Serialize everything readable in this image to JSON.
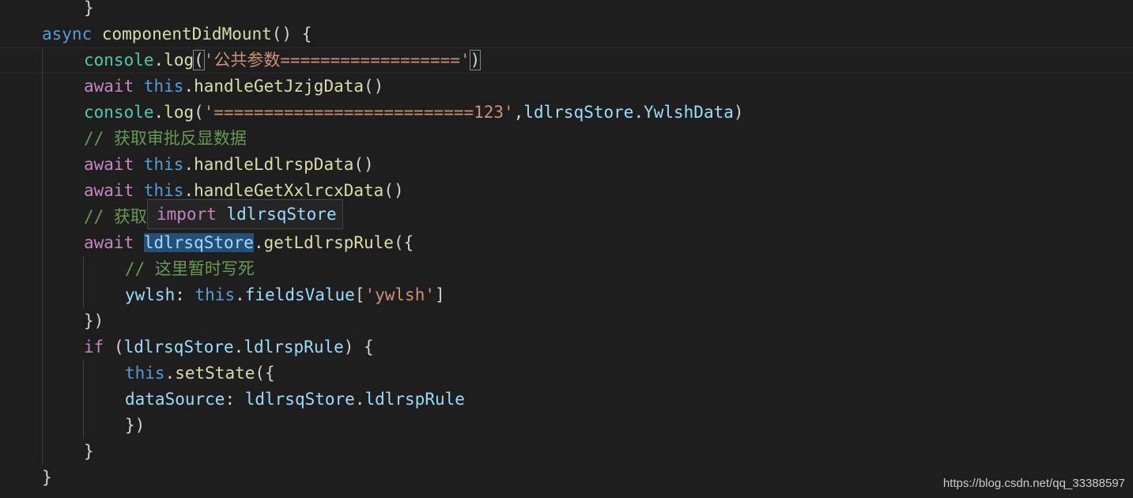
{
  "editor": {
    "lines": [
      [
        {
          "t": "}",
          "c": "pn"
        }
      ],
      [
        {
          "t": "async ",
          "c": "kw"
        },
        {
          "t": "componentDidMount",
          "c": "fn"
        },
        {
          "t": "() {",
          "c": "pn"
        }
      ],
      [
        {
          "t": "console",
          "c": "obj"
        },
        {
          "t": ".",
          "c": "pn"
        },
        {
          "t": "log",
          "c": "fn"
        },
        {
          "t": "(",
          "c": "pn",
          "b": 1
        },
        {
          "t": "'公共参数=================='",
          "c": "str"
        },
        {
          "t": ")",
          "c": "pn",
          "b": 1
        }
      ],
      [
        {
          "t": "await ",
          "c": "kw2"
        },
        {
          "t": "this",
          "c": "kw"
        },
        {
          "t": ".",
          "c": "pn"
        },
        {
          "t": "handleGetJzjgData",
          "c": "fn"
        },
        {
          "t": "()",
          "c": "pn"
        }
      ],
      [
        {
          "t": "console",
          "c": "obj"
        },
        {
          "t": ".",
          "c": "pn"
        },
        {
          "t": "log",
          "c": "fn"
        },
        {
          "t": "(",
          "c": "pn"
        },
        {
          "t": "'==========================123'",
          "c": "str"
        },
        {
          "t": ",",
          "c": "pn"
        },
        {
          "t": "ldlrsqStore",
          "c": "var"
        },
        {
          "t": ".",
          "c": "pn"
        },
        {
          "t": "YwlshData",
          "c": "var"
        },
        {
          "t": ")",
          "c": "pn"
        }
      ],
      [
        {
          "t": "// 获取审批反显数据",
          "c": "cm"
        }
      ],
      [
        {
          "t": "await ",
          "c": "kw2"
        },
        {
          "t": "this",
          "c": "kw"
        },
        {
          "t": ".",
          "c": "pn"
        },
        {
          "t": "handleLdlrspData",
          "c": "fn"
        },
        {
          "t": "()",
          "c": "pn"
        }
      ],
      [
        {
          "t": "await ",
          "c": "kw2"
        },
        {
          "t": "this",
          "c": "kw"
        },
        {
          "t": ".",
          "c": "pn"
        },
        {
          "t": "handleGetXxlrcxData",
          "c": "fn"
        },
        {
          "t": "()",
          "c": "pn"
        }
      ],
      [
        {
          "t": "// 获取",
          "c": "cm"
        }
      ],
      [
        {
          "t": "await ",
          "c": "kw2"
        },
        {
          "t": "ldlrsqStore",
          "c": "var",
          "h": 1
        },
        {
          "t": ".",
          "c": "pn"
        },
        {
          "t": "getLdlrspRule",
          "c": "fn"
        },
        {
          "t": "({",
          "c": "pn"
        }
      ],
      [
        {
          "t": "// 这里暂时写死",
          "c": "cm"
        }
      ],
      [
        {
          "t": "ywlsh",
          "c": "var"
        },
        {
          "t": ": ",
          "c": "pn"
        },
        {
          "t": "this",
          "c": "kw"
        },
        {
          "t": ".",
          "c": "pn"
        },
        {
          "t": "fieldsValue",
          "c": "var"
        },
        {
          "t": "[",
          "c": "pn"
        },
        {
          "t": "'ywlsh'",
          "c": "str"
        },
        {
          "t": "]",
          "c": "pn"
        }
      ],
      [
        {
          "t": "})",
          "c": "pn"
        }
      ],
      [
        {
          "t": "if ",
          "c": "kw2"
        },
        {
          "t": "(",
          "c": "pn"
        },
        {
          "t": "ldlrsqStore",
          "c": "var"
        },
        {
          "t": ".",
          "c": "pn"
        },
        {
          "t": "ldlrspRule",
          "c": "var"
        },
        {
          "t": ") {",
          "c": "pn"
        }
      ],
      [
        {
          "t": "this",
          "c": "kw"
        },
        {
          "t": ".",
          "c": "pn"
        },
        {
          "t": "setState",
          "c": "fn"
        },
        {
          "t": "({",
          "c": "pn"
        }
      ],
      [
        {
          "t": "dataSource",
          "c": "var"
        },
        {
          "t": ": ",
          "c": "pn"
        },
        {
          "t": "ldlrsqStore",
          "c": "var"
        },
        {
          "t": ".",
          "c": "pn"
        },
        {
          "t": "ldlrspRule",
          "c": "var"
        }
      ],
      [
        {
          "t": "})",
          "c": "pn"
        }
      ],
      [
        {
          "t": "}",
          "c": "pn"
        }
      ],
      [
        {
          "t": "}",
          "c": "pn"
        }
      ]
    ]
  },
  "hover": {
    "keyword": "import",
    "identifier": "ldlrsqStore"
  },
  "watermark": "https://blog.csdn.net/qq_33388597"
}
